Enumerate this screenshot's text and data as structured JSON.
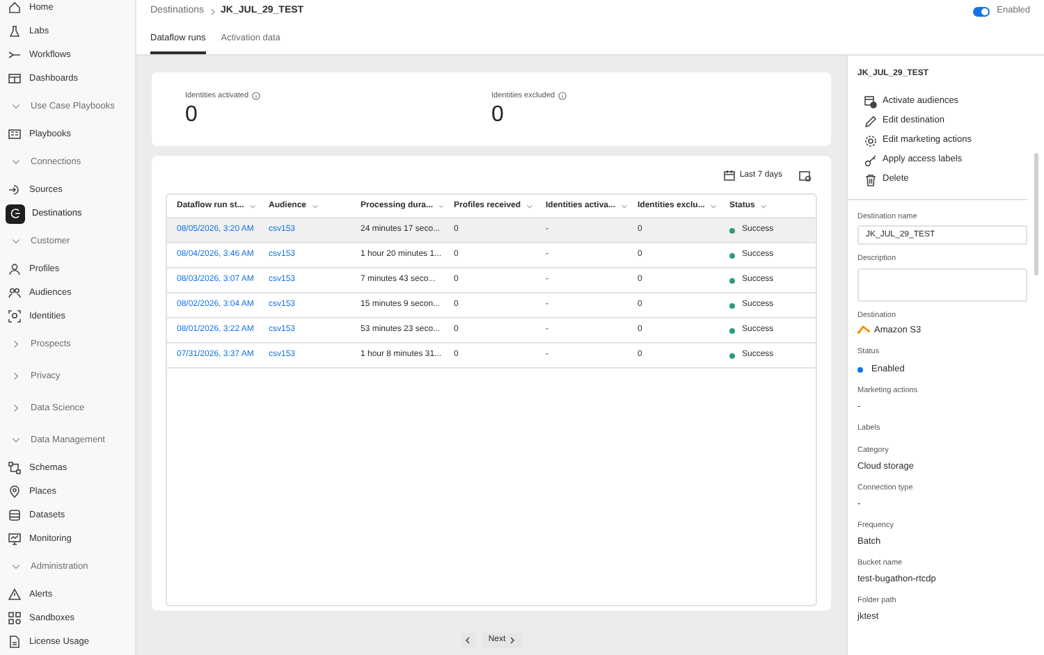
{
  "sidebar": {
    "items": [
      {
        "kind": "link",
        "label": "Home",
        "selected": false
      },
      {
        "kind": "link",
        "label": "Labs",
        "selected": false
      },
      {
        "kind": "link",
        "label": "Workflows",
        "selected": false
      },
      {
        "kind": "link",
        "label": "Dashboards",
        "selected": false
      },
      {
        "kind": "section",
        "label": "Use Case Playbooks",
        "expanded": true
      },
      {
        "kind": "link",
        "label": "Playbooks",
        "selected": false
      },
      {
        "kind": "section",
        "label": "Connections",
        "expanded": true
      },
      {
        "kind": "link",
        "label": "Sources",
        "selected": false
      },
      {
        "kind": "link",
        "label": "Destinations",
        "selected": true
      },
      {
        "kind": "section",
        "label": "Customer",
        "expanded": true
      },
      {
        "kind": "link",
        "label": "Profiles",
        "selected": false
      },
      {
        "kind": "link",
        "label": "Audiences",
        "selected": false
      },
      {
        "kind": "link",
        "label": "Identities",
        "selected": false
      },
      {
        "kind": "section",
        "label": "Prospects",
        "expanded": false
      },
      {
        "kind": "section",
        "label": "Privacy",
        "expanded": false
      },
      {
        "kind": "section",
        "label": "Data Science",
        "expanded": false
      },
      {
        "kind": "section",
        "label": "Data Management",
        "expanded": true
      },
      {
        "kind": "link",
        "label": "Schemas",
        "selected": false
      },
      {
        "kind": "link",
        "label": "Places",
        "selected": false
      },
      {
        "kind": "link",
        "label": "Datasets",
        "selected": false
      },
      {
        "kind": "link",
        "label": "Monitoring",
        "selected": false
      },
      {
        "kind": "section",
        "label": "Administration",
        "expanded": true
      },
      {
        "kind": "link",
        "label": "Alerts",
        "selected": false
      },
      {
        "kind": "link",
        "label": "Sandboxes",
        "selected": false
      },
      {
        "kind": "link",
        "label": "License Usage",
        "selected": false
      }
    ]
  },
  "breadcrumb": [
    "Destinations",
    "JK_JUL_29_TEST"
  ],
  "toggle": {
    "label": "Enabled",
    "on": true
  },
  "tabs": [
    {
      "label": "Dataflow runs",
      "selected": true
    },
    {
      "label": "Activation data",
      "selected": false
    }
  ],
  "metrics": [
    {
      "label": "Identities activated",
      "value": "0"
    },
    {
      "label": "Identities excluded",
      "value": "0"
    }
  ],
  "date_filter": {
    "label": "Last 7 days"
  },
  "table": {
    "columns": [
      "Dataflow run st...",
      "Audience",
      "Processing dura...",
      "Profiles received",
      "Identities activa...",
      "Identities exclu...",
      "Status"
    ],
    "rows": [
      {
        "selected": true,
        "cells": [
          "08/05/2026, 3:20 AM",
          "csv153",
          "24 minutes 17 seco...",
          "0",
          "-",
          "0",
          "Success"
        ]
      },
      {
        "selected": false,
        "cells": [
          "08/04/2026, 3:46 AM",
          "csv153",
          "1 hour 20 minutes 1...",
          "0",
          "-",
          "0",
          "Success"
        ]
      },
      {
        "selected": false,
        "cells": [
          "08/03/2026, 3:07 AM",
          "csv153",
          "7 minutes 43 seco...",
          "0",
          "-",
          "0",
          "Success"
        ]
      },
      {
        "selected": false,
        "cells": [
          "08/02/2026, 3:04 AM",
          "csv153",
          "15 minutes 9 secon...",
          "0",
          "-",
          "0",
          "Success"
        ]
      },
      {
        "selected": false,
        "cells": [
          "08/01/2026, 3:22 AM",
          "csv153",
          "53 minutes 23 seco...",
          "0",
          "-",
          "0",
          "Success"
        ]
      },
      {
        "selected": false,
        "cells": [
          "07/31/2026, 3:37 AM",
          "csv153",
          "1 hour 8 minutes 31...",
          "0",
          "-",
          "0",
          "Success"
        ]
      }
    ]
  },
  "pagination": {
    "next": "Next"
  },
  "details": {
    "title": "JK_JUL_29_TEST",
    "actions": [
      "Activate audiences",
      "Edit destination",
      "Edit marketing actions",
      "Apply access labels",
      "Delete"
    ],
    "fields": [
      {
        "kind": "input",
        "label": "Destination name",
        "value": "JK_JUL_29_TEST"
      },
      {
        "kind": "textarea",
        "label": "Description"
      },
      {
        "kind": "logo",
        "label": "Destination",
        "value": "Amazon S3"
      },
      {
        "kind": "dot",
        "label": "Status",
        "value": "Enabled"
      },
      {
        "kind": "text",
        "label": "Marketing actions",
        "value": "-"
      },
      {
        "kind": "text",
        "label": "Labels"
      },
      {
        "kind": "text",
        "label": "Category",
        "value": "Cloud storage"
      },
      {
        "kind": "text",
        "label": "Connection type",
        "value": "-"
      },
      {
        "kind": "text",
        "label": "Frequency",
        "value": "Batch"
      },
      {
        "kind": "text",
        "label": "Bucket name",
        "value": "test-bugathon-rtcdp"
      },
      {
        "kind": "text",
        "label": "Folder path",
        "value": "jktest"
      }
    ]
  }
}
